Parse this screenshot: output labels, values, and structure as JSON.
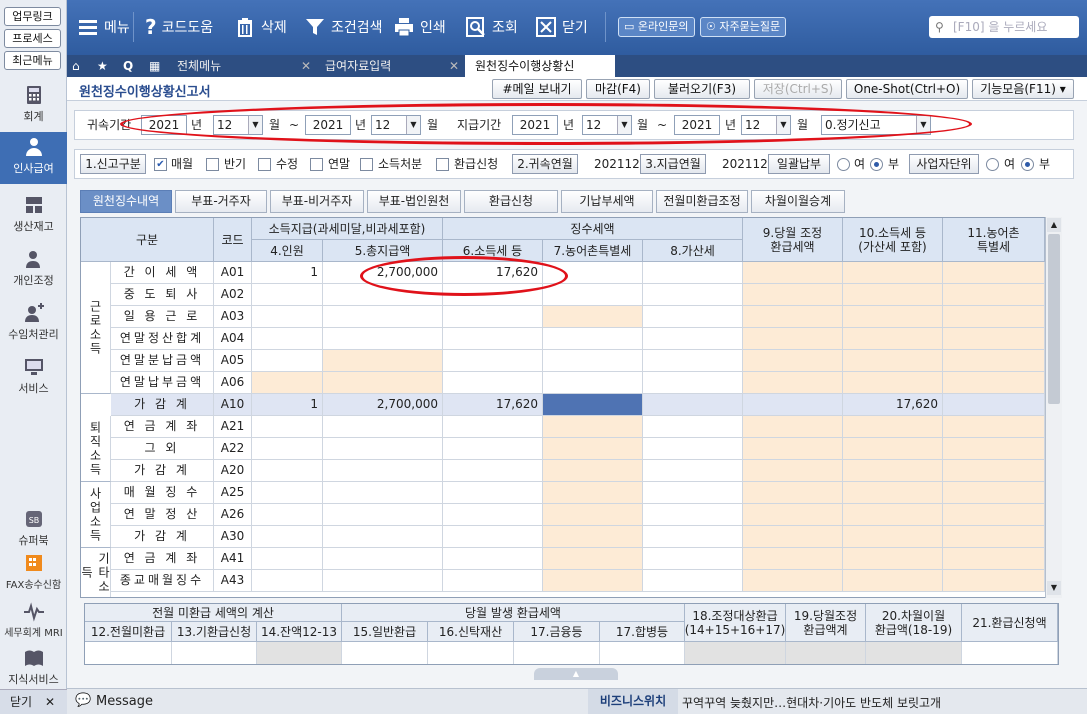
{
  "sidebar": {
    "top_buttons": [
      "업무링크",
      "프로세스",
      "최근메뉴"
    ],
    "nav": [
      {
        "label": "회계",
        "icon": "calculator-icon"
      },
      {
        "label": "인사급여",
        "icon": "person-icon",
        "active": true
      },
      {
        "label": "생산재고",
        "icon": "boxes-icon"
      },
      {
        "label": "개인조정",
        "icon": "user-settings-icon"
      },
      {
        "label": "수임처관리",
        "icon": "user-plus-icon"
      },
      {
        "label": "서비스",
        "icon": "monitor-icon"
      },
      {
        "label": "슈퍼북",
        "icon": "superbook-icon"
      },
      {
        "label": "FAX송수신함",
        "icon": "fax-icon"
      },
      {
        "label": "세무회계 MRI",
        "icon": "pulse-icon"
      },
      {
        "label": "지식서비스",
        "icon": "book-icon"
      }
    ],
    "close_label": "닫기"
  },
  "toolbar": {
    "menu": "메뉴",
    "code_help": "코드도움",
    "delete": "삭제",
    "filter_search": "조건검색",
    "print": "인쇄",
    "query": "조회",
    "close": "닫기",
    "online_inquiry": "온라인문의",
    "faq": "자주묻는질문",
    "search_placeholder": "[F10] 을 누르세요"
  },
  "tabs": {
    "all_menu": "전체메뉴",
    "items": [
      "급여자료입력",
      "원천징수이행상황신"
    ]
  },
  "titlebar": {
    "title": "원천징수이행상황신고서",
    "buttons": [
      "#메일 보내기",
      "마감(F4)",
      "불러오기(F3)",
      "저장(Ctrl+S)",
      "One-Shot(Ctrl+O)",
      "기능모음(F11)"
    ]
  },
  "period": {
    "belong_label": "귀속기간",
    "belong_from_year": "2021",
    "belong_from_month": "12",
    "belong_to_year": "2021",
    "belong_to_month": "12",
    "pay_label": "지급기간",
    "pay_from_year": "2021",
    "pay_from_month": "12",
    "pay_to_year": "2021",
    "pay_to_month": "12",
    "year_unit": "년",
    "month_unit": "월",
    "tilde": "~",
    "report_type": "0.정기신고"
  },
  "options": {
    "report_kind": "1.신고구분",
    "monthly": "매월",
    "semi": "반기",
    "correction": "수정",
    "year_end": "연말",
    "income_disposal": "소득처분",
    "refund_apply": "환급신청",
    "belong_ym_btn": "2.귀속연월",
    "belong_ym": "202112",
    "pay_ym_btn": "3.지급연월",
    "pay_ym": "202112",
    "bulk_btn": "일괄납부",
    "yes": "여",
    "no": "부",
    "biz_unit_btn": "사업자단위"
  },
  "subtabs": [
    "원천징수내역",
    "부표-거주자",
    "부표-비거주자",
    "부표-법인원천",
    "환급신청",
    "기납부세액",
    "전월미환급조정",
    "차월이월승계"
  ],
  "grid": {
    "headers": {
      "category": "구분",
      "code": "코드",
      "income_pay": "소득지급(과세미달,비과세포함)",
      "tax_collected": "징수세액",
      "people": "4.인원",
      "total_pay": "5.총지급액",
      "income_tax": "6.소득세 등",
      "rural_tax": "7.농어촌특별세",
      "add_tax": "8.가산세",
      "adj_refund": "9.당월 조정\n환급세액",
      "income_tax_paid": "10.소득세 등\n(가산세 포함)",
      "rural_paid": "11.농어촌\n특별세"
    },
    "groups": [
      "근로소득",
      "퇴직소득",
      "사업소득",
      "기타소득"
    ],
    "rows": [
      {
        "label": "간 이 세 액",
        "code": "A01",
        "people": "1",
        "total": "2,700,000",
        "tax": "17,620",
        "paid": ""
      },
      {
        "label": "중 도 퇴 사",
        "code": "A02",
        "people": "",
        "total": "",
        "tax": "",
        "paid": ""
      },
      {
        "label": "일 용 근 로",
        "code": "A03",
        "people": "",
        "total": "",
        "tax": "",
        "paid": ""
      },
      {
        "label": "연말정산합계",
        "code": "A04",
        "people": "",
        "total": "",
        "tax": "",
        "paid": ""
      },
      {
        "label": "연말분납금액",
        "code": "A05",
        "people": "",
        "total": "",
        "tax": "",
        "paid": ""
      },
      {
        "label": "연말납부금액",
        "code": "A06",
        "people": "",
        "total": "",
        "tax": "",
        "paid": ""
      },
      {
        "label": "가 감 계",
        "code": "A10",
        "people": "1",
        "total": "2,700,000",
        "tax": "17,620",
        "paid": "17,620"
      },
      {
        "label": "연 금 계 좌",
        "code": "A21",
        "people": "",
        "total": "",
        "tax": "",
        "paid": ""
      },
      {
        "label": "그 외",
        "code": "A22",
        "people": "",
        "total": "",
        "tax": "",
        "paid": ""
      },
      {
        "label": "가 감 계",
        "code": "A20",
        "people": "",
        "total": "",
        "tax": "",
        "paid": ""
      },
      {
        "label": "매 월 징 수",
        "code": "A25",
        "people": "",
        "total": "",
        "tax": "",
        "paid": ""
      },
      {
        "label": "연 말 정 산",
        "code": "A26",
        "people": "",
        "total": "",
        "tax": "",
        "paid": ""
      },
      {
        "label": "가 감 계",
        "code": "A30",
        "people": "",
        "total": "",
        "tax": "",
        "paid": ""
      },
      {
        "label": "연 금 계 좌",
        "code": "A41",
        "people": "",
        "total": "",
        "tax": "",
        "paid": ""
      },
      {
        "label": "종교매월징수",
        "code": "A43",
        "people": "",
        "total": "",
        "tax": "",
        "paid": ""
      }
    ]
  },
  "refund": {
    "prev": "전월 미환급 세액의 계산",
    "cur": "당월 발생 환급세액",
    "c12": "12.전월미환급",
    "c13": "13.기환급신청",
    "c14": "14.잔액12-13",
    "c15": "15.일반환급",
    "c16": "16.신탁재산",
    "c17": "17.금융등",
    "c17b": "17.합병등",
    "c18": "18.조정대상환급\n(14+15+16+17)",
    "c19": "19.당월조정\n환급액계",
    "c20": "20.차월이월\n환급액(18-19)",
    "c21": "21.환급신청액"
  },
  "status": {
    "message": "Message",
    "biz_weather": "비즈니스위치",
    "news": "꾸역꾸역 늦췄지만…현대차·기아도 반도체 보릿고개"
  }
}
